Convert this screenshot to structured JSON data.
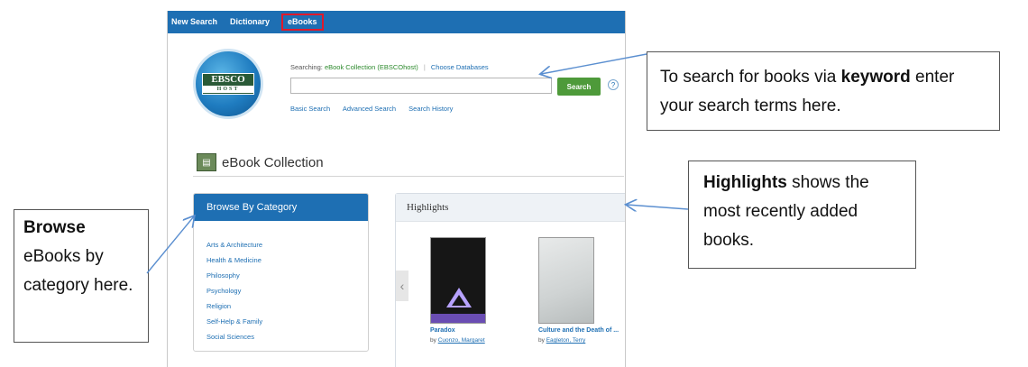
{
  "topnav": {
    "items": [
      {
        "label": "New Search"
      },
      {
        "label": "Dictionary"
      },
      {
        "label": "eBooks"
      }
    ]
  },
  "logo": {
    "text": "EBSCO",
    "subtext": "HOST"
  },
  "search": {
    "searching_prefix": "Searching:",
    "database": "eBook Collection (EBSCOhost)",
    "choose_databases": "Choose Databases",
    "input_value": "",
    "button_label": "Search",
    "help": "?",
    "links": [
      "Basic Search",
      "Advanced Search",
      "Search History"
    ]
  },
  "collection": {
    "title": "eBook Collection"
  },
  "browse": {
    "heading": "Browse By Category",
    "categories": [
      "Arts & Architecture",
      "Health & Medicine",
      "Philosophy",
      "Psychology",
      "Religion",
      "Self-Help & Family",
      "Social Sciences"
    ]
  },
  "highlights": {
    "heading": "Highlights",
    "prev_glyph": "‹",
    "books": [
      {
        "title": "Paradox",
        "by": "by",
        "author": "Cuonzo, Margaret"
      },
      {
        "title": "Culture and the Death of ...",
        "by": "by",
        "author": "Eagleton, Terry"
      }
    ]
  },
  "callouts": {
    "search": {
      "part1": "To search for books via ",
      "bold": "keyword",
      "part2": " enter your search terms here."
    },
    "highlights": {
      "bold": "Highlights",
      "rest": " shows the most recently added books."
    },
    "browse": {
      "bold": "Browse",
      "rest": " eBooks by category here."
    }
  },
  "colors": {
    "nav_blue": "#1e6fb3",
    "search_green": "#4e9a3a",
    "active_outline": "#e0192b",
    "arrow": "#5b8fd0"
  }
}
